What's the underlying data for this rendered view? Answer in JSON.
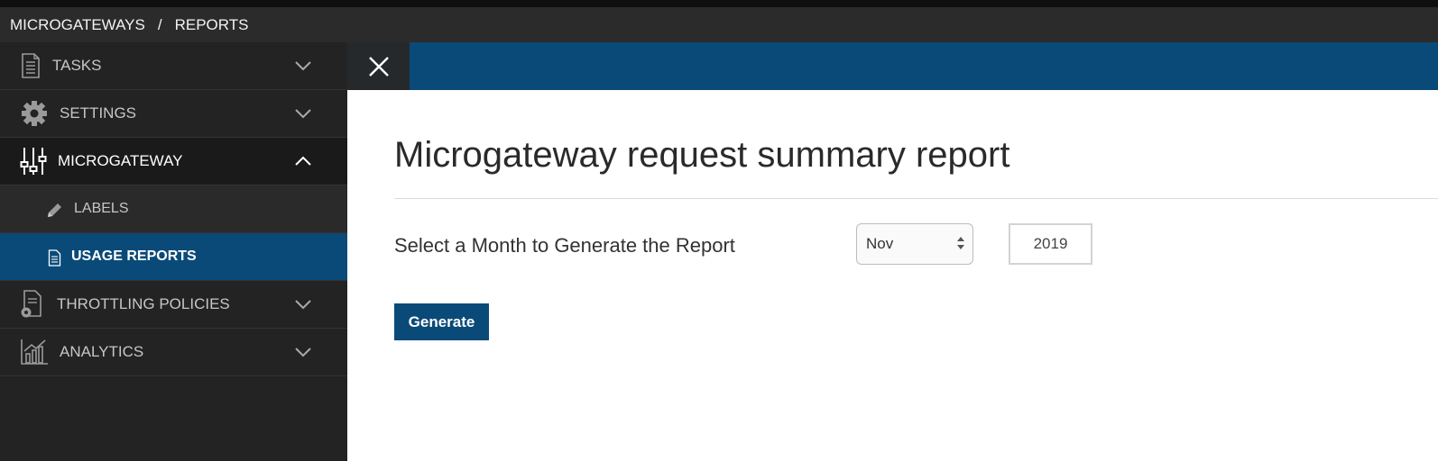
{
  "breadcrumb": {
    "root": "MICROGATEWAYS",
    "separator": "/",
    "current": "REPORTS"
  },
  "sidebar": {
    "items": [
      {
        "label": "TASKS",
        "icon": "document-list-icon",
        "chevron": "down"
      },
      {
        "label": "SETTINGS",
        "icon": "gear-icon",
        "chevron": "down"
      },
      {
        "label": "MICROGATEWAY",
        "icon": "sliders-icon",
        "chevron": "up"
      },
      {
        "label": "LABELS",
        "icon": "pencil-icon"
      },
      {
        "label": "USAGE REPORTS",
        "icon": "document-icon"
      },
      {
        "label": "THROTTLING POLICIES",
        "icon": "policy-document-icon",
        "chevron": "down"
      },
      {
        "label": "ANALYTICS",
        "icon": "bar-chart-icon",
        "chevron": "down"
      }
    ]
  },
  "main": {
    "title": "Microgateway request summary report",
    "month_label": "Select a Month to Generate the Report",
    "month_value": "Nov",
    "year_value": "2019",
    "generate_label": "Generate"
  },
  "colors": {
    "accent": "#0a4a78",
    "sidebar_bg": "#232323",
    "topbar_bg": "#2b2b2b"
  }
}
